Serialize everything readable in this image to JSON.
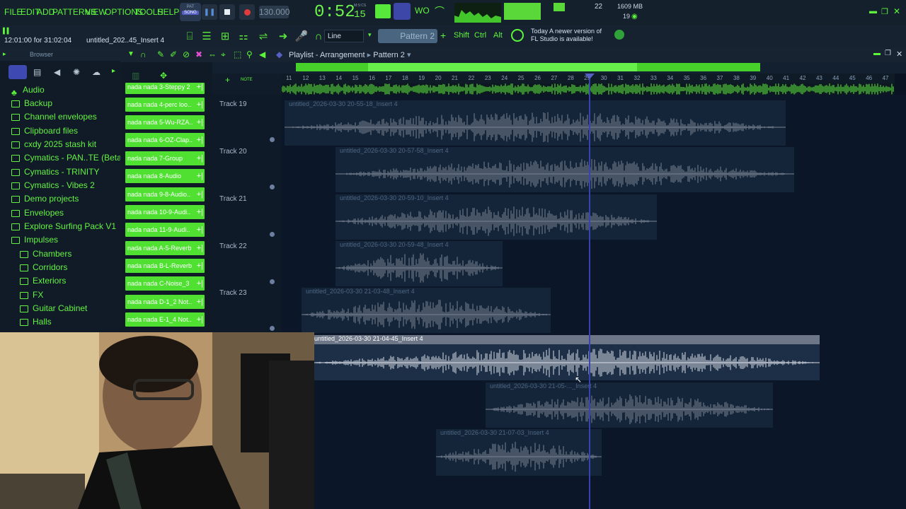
{
  "menu": [
    "FILE",
    "EDIT",
    "ADD",
    "PATTERNS",
    "VIEW",
    "OPTIONS",
    "TOOLS",
    "HELP"
  ],
  "transport": {
    "mode_label": "PAT",
    "mode_sub": "SONG",
    "time": "0:52",
    "time_frames": "15",
    "time_unit": "M:S:CS",
    "bpm": "130.000"
  },
  "status": {
    "ram": "1609 MB",
    "cpu_value": "22",
    "poly": "19"
  },
  "hint": {
    "time_range": "12:01:00 for 31:02:04",
    "file": "untitled_202..45_Insert 4"
  },
  "snap": {
    "value": "Line"
  },
  "pattern": {
    "label": "Pattern 2"
  },
  "modifiers": [
    "Shift",
    "Ctrl",
    "Alt"
  ],
  "news": {
    "line1": "Today  A newer version of",
    "line2": "FL Studio is available!"
  },
  "browser": {
    "title": "Browser",
    "folders": [
      "Audio",
      "Backup",
      "Channel envelopes",
      "Clipboard files",
      "cxdy 2025 stash kit",
      "Cymatics - PAN..TE (Beta Pack)",
      "Cymatics - TRINITY",
      "Cymatics - Vibes 2",
      "Demo projects",
      "Envelopes",
      "Explore Surfing Pack V1",
      "Impulses"
    ],
    "subfolders": [
      "Chambers",
      "Corridors",
      "Exteriors",
      "FX",
      "Guitar Cabinet",
      "Halls"
    ]
  },
  "channels": [
    "nada nada 3-Steppy 2",
    "nada nada 4-perc loo..",
    "nada nada 5-Wu-RZA..",
    "nada nada 6-OZ-Clap..",
    "nada nada 7-Group",
    "nada nada 8-Audio",
    "nada nada 9-8-Audio..",
    "nada nada 10-9-Audi..",
    "nada nada 11-9-Audi..",
    "nada nada A-5-Reverb",
    "nada nada B-L-Reverb",
    "nada nada C-Noise_3",
    "nada nada D-1_2 Not..",
    "nada nada E-1_4 Not.."
  ],
  "playlist": {
    "title": "Playlist - Arrangement",
    "pattern": "Pattern 2",
    "ruler": [
      "11",
      "12",
      "13",
      "14",
      "15",
      "16",
      "17",
      "18",
      "19",
      "20",
      "21",
      "22",
      "23",
      "24",
      "25",
      "26",
      "27",
      "28",
      "29",
      "30",
      "31",
      "32",
      "33",
      "34",
      "35",
      "36",
      "37",
      "38",
      "39",
      "40",
      "41",
      "42",
      "43",
      "44",
      "45",
      "46",
      "47"
    ],
    "tracks": [
      "Track 19",
      "Track 20",
      "Track 21",
      "Track 22",
      "Track 23"
    ],
    "clips": [
      "untitled_2026-03-30 20-55-18_Insert 4",
      "untitled_2026-03-30 20-57-58_Insert 4",
      "untitled_2026-03-30 20-59-10_Insert 4",
      "untitled_2026-03-30 20-59-48_Insert 4",
      "untitled_2026-03-30 21-03-48_Insert 4",
      "untitled_2026-03-30 21-04-45_Insert 4",
      "untitled_2026-03-30 21-05-..._Insert 4",
      "untitled_2026-03-30 21-07-03_Insert 4"
    ]
  },
  "colors": {
    "accent": "#5df53c",
    "clip_bg": "#14253a",
    "playhead": "#3a42b0"
  }
}
